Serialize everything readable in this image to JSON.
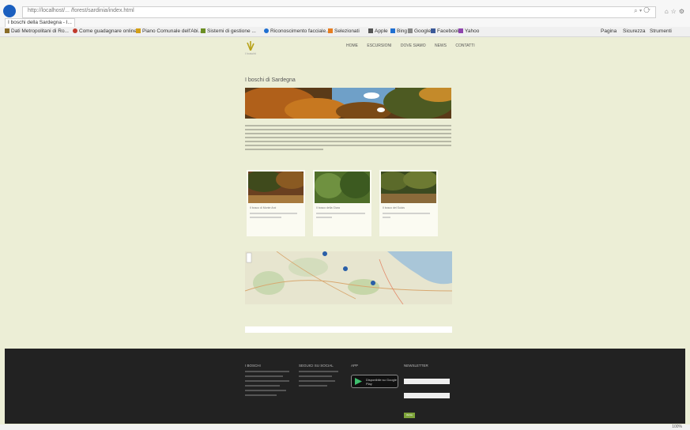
{
  "browser": {
    "address": "http://localhost/... /forest/sardinia/index.html",
    "tab_title": "I boschi della Sardegna - I...",
    "favorites": [
      "Dati Metropolitani di Ro...",
      "Come guadagnare online",
      "Piano Comunale dell'Abi...",
      "Sistemi di gestione ...",
      "Riconoscimento facciale...",
      "Selezionati",
      "Apple",
      "Bing",
      "Google",
      "Facebook",
      "Yahoo"
    ],
    "commands": [
      "Pagina",
      "Sicurezza",
      "Strumenti"
    ],
    "zoom": "100%"
  },
  "site": {
    "logo_text": "I boschi",
    "nav": [
      "HOME",
      "ESCURSIONI",
      "DOVE SIAMO",
      "NEWS",
      "CONTATTI"
    ],
    "page_title": "I boschi di Sardegna",
    "cards": [
      {
        "title": "Il bosco di Monte Arci",
        "lines": 2
      },
      {
        "title": "Il bosco della Giara",
        "lines": 2
      },
      {
        "title": "Il bosco del Sulcis",
        "lines": 2
      }
    ]
  },
  "footer": {
    "col1_head": "I BOSCHI",
    "col2_head": "SEGUICI SU SOCIAL",
    "col3_head": "APP",
    "col4_head": "NEWSLETTER",
    "store_label": "Disponibile su Google Play",
    "submit": "INVIA"
  },
  "colors": {
    "page_bg": "#eceed6",
    "footer_bg": "#222222",
    "accent": "#7ea43a"
  }
}
